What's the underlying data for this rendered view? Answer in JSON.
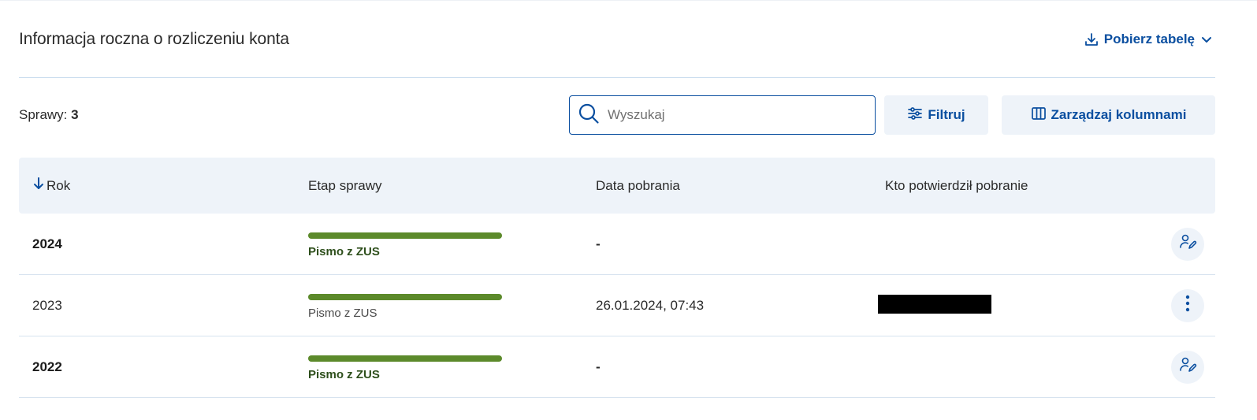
{
  "header": {
    "title": "Informacja roczna o rozliczeniu konta",
    "download_label": "Pobierz tabelę"
  },
  "toolbar": {
    "count_label": "Sprawy:",
    "count_value": "3",
    "search_placeholder": "Wyszukaj",
    "filter_label": "Filtruj",
    "columns_label": "Zarządzaj kolumnami"
  },
  "table": {
    "columns": [
      "Rok",
      "Etap sprawy",
      "Data pobrania",
      "Kto potwierdził pobranie"
    ],
    "rows": [
      {
        "year": "2024",
        "stage": "Pismo z ZUS",
        "date": "-",
        "who": "",
        "action_icon": "person-edit-icon"
      },
      {
        "year": "2023",
        "stage": "Pismo z ZUS",
        "date": "26.01.2024, 07:43",
        "who": "",
        "action_icon": "more-vertical-icon"
      },
      {
        "year": "2022",
        "stage": "Pismo z ZUS",
        "date": "-",
        "who": "",
        "action_icon": "person-edit-icon"
      }
    ]
  },
  "colors": {
    "brand_blue": "#0b4fa0",
    "light_blue_bg": "#eef3f9",
    "progress_green": "#5c8a2b"
  }
}
